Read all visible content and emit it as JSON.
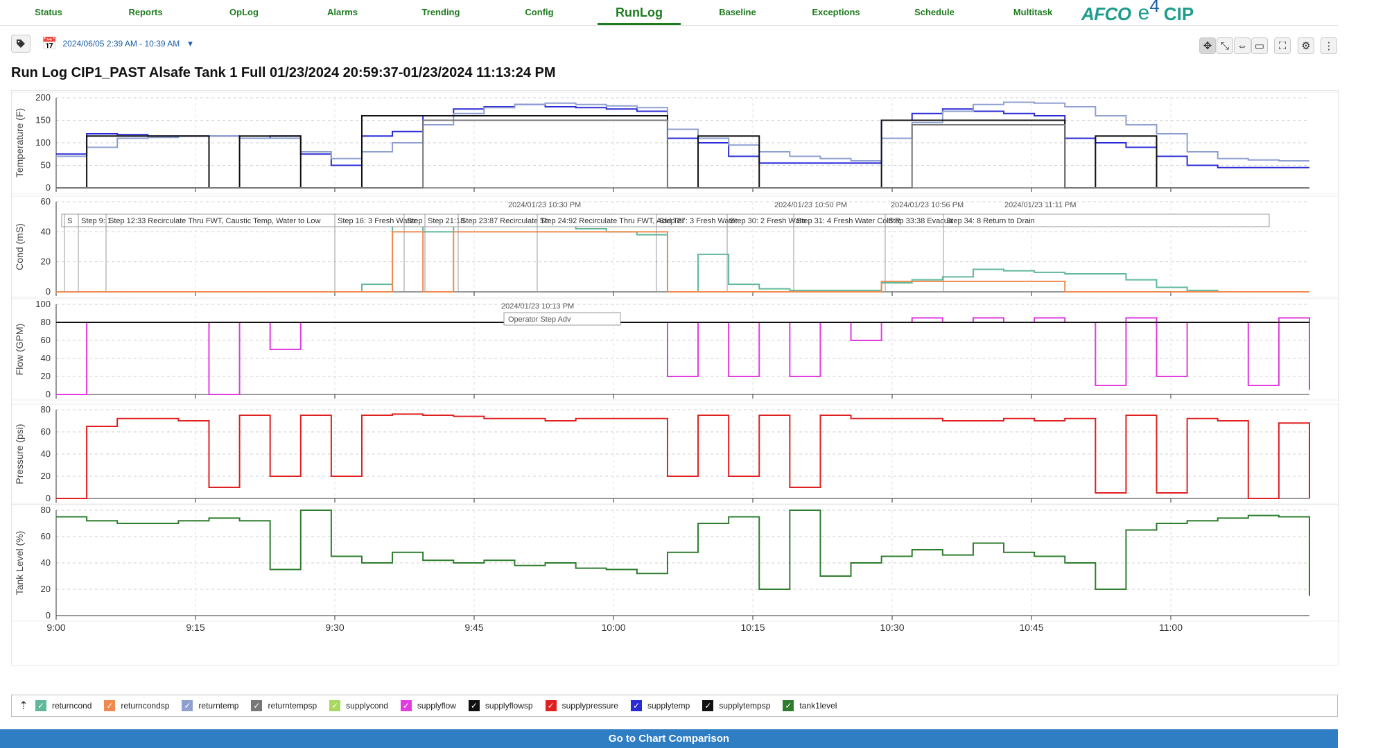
{
  "nav": {
    "items": [
      {
        "label": "Status"
      },
      {
        "label": "Reports"
      },
      {
        "label": "OpLog"
      },
      {
        "label": "Alarms"
      },
      {
        "label": "Trending"
      },
      {
        "label": "Config"
      },
      {
        "label": "RunLog"
      },
      {
        "label": "Baseline"
      },
      {
        "label": "Exceptions"
      },
      {
        "label": "Schedule"
      },
      {
        "label": "Multitask"
      }
    ],
    "active": "RunLog",
    "accent_color": "#1e7b1e"
  },
  "brand": {
    "afco": "AFCO",
    "e": "e",
    "four": "4",
    "cip": "CIP"
  },
  "toolbar": {
    "tag_icon": "tag-icon",
    "date_range": "2024/06/05 2:39 AM - 10:39 AM",
    "tools": [
      "pan-icon",
      "zoom-xy-icon",
      "zoom-x-icon",
      "select-icon",
      "fullscreen-icon",
      "gear-icon",
      "more-vertical-icon"
    ]
  },
  "title": "Run Log CIP1_PAST Alsafe Tank 1 Full 01/23/2024 20:59:37-01/23/2024 11:13:24 PM",
  "chart_data": {
    "type": "line",
    "x_ticks": [
      "9:00",
      "9:15",
      "9:30",
      "9:45",
      "10:00",
      "10:15",
      "10:30",
      "10:45",
      "11:00"
    ],
    "panels": [
      {
        "ylabel": "Temperature (F)",
        "ylim": [
          0,
          200
        ],
        "yticks": [
          "200",
          "150",
          "100",
          "50",
          "0"
        ],
        "series": [
          {
            "name": "supplytemp",
            "color": "#2b2bd6",
            "values": [
              75,
              120,
              118,
              115,
              115,
              115,
              110,
              115,
              75,
              50,
              115,
              125,
              160,
              175,
              180,
              185,
              180,
              178,
              175,
              170,
              110,
              100,
              70,
              55,
              55,
              55,
              55,
              150,
              165,
              175,
              170,
              165,
              160,
              110,
              100,
              90,
              70,
              50,
              45,
              45,
              45,
              45
            ]
          },
          {
            "name": "returntemp",
            "color": "#8fa0d0",
            "values": [
              70,
              90,
              110,
              112,
              115,
              115,
              110,
              110,
              80,
              65,
              80,
              100,
              140,
              165,
              178,
              185,
              188,
              185,
              182,
              178,
              130,
              110,
              95,
              80,
              70,
              65,
              60,
              110,
              145,
              170,
              185,
              190,
              188,
              180,
              160,
              140,
              120,
              80,
              65,
              62,
              60,
              60
            ]
          },
          {
            "name": "supplytempsp",
            "color": "#111111",
            "values": [
              0,
              115,
              115,
              115,
              115,
              0,
              115,
              115,
              0,
              0,
              160,
              160,
              160,
              160,
              160,
              160,
              160,
              160,
              160,
              160,
              0,
              115,
              115,
              0,
              0,
              0,
              0,
              150,
              150,
              150,
              150,
              150,
              150,
              0,
              115,
              115,
              0,
              0,
              0,
              0,
              0,
              0
            ]
          },
          {
            "name": "returntempsp",
            "color": "#777777",
            "values": [
              0,
              0,
              0,
              0,
              0,
              0,
              0,
              0,
              0,
              0,
              0,
              0,
              150,
              150,
              150,
              150,
              150,
              150,
              150,
              150,
              0,
              0,
              0,
              0,
              0,
              0,
              0,
              0,
              140,
              140,
              140,
              140,
              140,
              0,
              0,
              0,
              0,
              0,
              0,
              0,
              0,
              0
            ]
          }
        ]
      },
      {
        "ylabel": "Cond (mS)",
        "ylim": [
          0,
          60
        ],
        "yticks": [
          "60",
          "40",
          "20",
          "0"
        ],
        "step_labels": [
          "S",
          "Step 9: 1",
          "Step 12:33 Recirculate Thru FWT, Caustic Temp, Water to Low",
          "Step 16: 3 Fresh Water",
          "Step",
          "Step 21:18",
          "Step 23:87 Recirculate Th",
          "Step 24:92 Recirculate Thru FWT, Acid Ter",
          "Step 27: 3 Fresh Water",
          "Step 30: 2 Fresh Wate",
          "Step 31: 4 Fresh Water Cold R",
          "Step 33:38 Evacua",
          "Step 34: 8 Return to Drain"
        ],
        "time_labels": [
          "2024/01/23 10:30 PM",
          "2024/01/23 10:50 PM",
          "2024/01/23 10:56 PM",
          "2024/01/23 11:11 PM"
        ],
        "series": [
          {
            "name": "returncond",
            "color": "#5fb89a",
            "values": [
              0,
              0,
              0,
              0,
              0,
              0,
              0,
              0,
              0,
              0,
              5,
              45,
              40,
              45,
              48,
              46,
              44,
              42,
              40,
              38,
              0,
              25,
              5,
              2,
              1,
              1,
              1,
              6,
              8,
              10,
              15,
              14,
              13,
              12,
              12,
              8,
              3,
              1,
              0,
              0,
              0,
              0
            ]
          },
          {
            "name": "returncondsp",
            "color": "#f08a50",
            "values": [
              0,
              0,
              0,
              0,
              0,
              0,
              0,
              0,
              0,
              0,
              0,
              40,
              0,
              40,
              40,
              40,
              40,
              40,
              40,
              40,
              0,
              0,
              0,
              0,
              0,
              0,
              0,
              7,
              7,
              7,
              7,
              7,
              7,
              0,
              0,
              0,
              0,
              0,
              0,
              0,
              0,
              0
            ]
          }
        ]
      },
      {
        "ylabel": "Flow (GPM)",
        "ylim": [
          0,
          100
        ],
        "yticks": [
          "100",
          "80",
          "60",
          "40",
          "20",
          "0"
        ],
        "tooltip": {
          "time": "2024/01/23 10:13 PM",
          "text": "Operator Step Adv"
        },
        "series": [
          {
            "name": "supplyflow",
            "color": "#e03ce0",
            "values": [
              0,
              80,
              80,
              80,
              80,
              0,
              80,
              50,
              80,
              80,
              80,
              80,
              80,
              80,
              80,
              80,
              80,
              80,
              80,
              80,
              20,
              80,
              20,
              80,
              20,
              80,
              60,
              80,
              85,
              80,
              85,
              80,
              85,
              80,
              10,
              85,
              20,
              80,
              80,
              10,
              85,
              5
            ]
          },
          {
            "name": "supplyflowsp",
            "color": "#111111",
            "values": [
              80,
              80,
              80,
              80,
              80,
              80,
              80,
              80,
              80,
              80,
              80,
              80,
              80,
              80,
              80,
              80,
              80,
              80,
              80,
              80,
              80,
              80,
              80,
              80,
              80,
              80,
              80,
              80,
              80,
              80,
              80,
              80,
              80,
              80,
              80,
              80,
              80,
              80,
              80,
              80,
              80,
              80
            ]
          }
        ]
      },
      {
        "ylabel": "Pressure (psi)",
        "ylim": [
          0,
          80
        ],
        "yticks": [
          "80",
          "60",
          "40",
          "20",
          "0"
        ],
        "series": [
          {
            "name": "supplypressure",
            "color": "#e02020",
            "values": [
              0,
              65,
              72,
              72,
              70,
              10,
              75,
              20,
              75,
              20,
              75,
              76,
              75,
              74,
              72,
              72,
              70,
              72,
              72,
              72,
              20,
              75,
              20,
              75,
              10,
              75,
              72,
              72,
              72,
              70,
              70,
              72,
              70,
              72,
              5,
              75,
              5,
              72,
              70,
              0,
              68,
              0
            ]
          }
        ]
      },
      {
        "ylabel": "Tank Level (%)",
        "ylim": [
          0,
          80
        ],
        "yticks": [
          "80",
          "60",
          "40",
          "20",
          "0"
        ],
        "series": [
          {
            "name": "tank1level",
            "color": "#2e7d2e",
            "values": [
              75,
              72,
              70,
              70,
              72,
              74,
              72,
              35,
              80,
              45,
              40,
              48,
              42,
              40,
              42,
              38,
              40,
              36,
              35,
              32,
              48,
              70,
              75,
              20,
              80,
              30,
              40,
              45,
              50,
              46,
              55,
              48,
              45,
              40,
              20,
              65,
              70,
              72,
              74,
              76,
              75,
              15
            ]
          }
        ]
      }
    ]
  },
  "legend": {
    "items": [
      {
        "label": "returncond",
        "color": "#5fb89a"
      },
      {
        "label": "returncondsp",
        "color": "#f08a50"
      },
      {
        "label": "returntemp",
        "color": "#8fa0d0"
      },
      {
        "label": "returntempsp",
        "color": "#777777"
      },
      {
        "label": "supplycond",
        "color": "#a8d860"
      },
      {
        "label": "supplyflow",
        "color": "#e03ce0"
      },
      {
        "label": "supplyflowsp",
        "color": "#111111"
      },
      {
        "label": "supplypressure",
        "color": "#e02020"
      },
      {
        "label": "supplytemp",
        "color": "#2b2bd6"
      },
      {
        "label": "supplytempsp",
        "color": "#111111"
      },
      {
        "label": "tank1level",
        "color": "#2e7d2e"
      }
    ]
  },
  "footer": {
    "compare_label": "Go to Chart Comparison",
    "color": "#2f7dc2"
  }
}
